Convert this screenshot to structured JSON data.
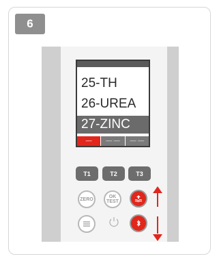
{
  "step": {
    "number": "6"
  },
  "screen": {
    "menu_items": [
      "25-TH",
      "26-UREA",
      "27-ZINC"
    ],
    "selected_index": 2,
    "softkeys": [
      "—",
      "— —",
      "— —"
    ]
  },
  "test_keys": [
    "T1",
    "T2",
    "T3"
  ],
  "buttons": {
    "zero": "ZERO",
    "ok_test_line1": "OK",
    "ok_test_line2": "TEST"
  },
  "icons": {
    "up_key": "water-up-icon",
    "down_key": "bluetooth-icon",
    "menu": "menu-lines-icon",
    "power": "power-icon",
    "arrow": "double-arrow-icon"
  },
  "colors": {
    "accent_red": "#e1261c",
    "key_gray": "#6d6d6d",
    "badge_gray": "#8f8f8f"
  }
}
